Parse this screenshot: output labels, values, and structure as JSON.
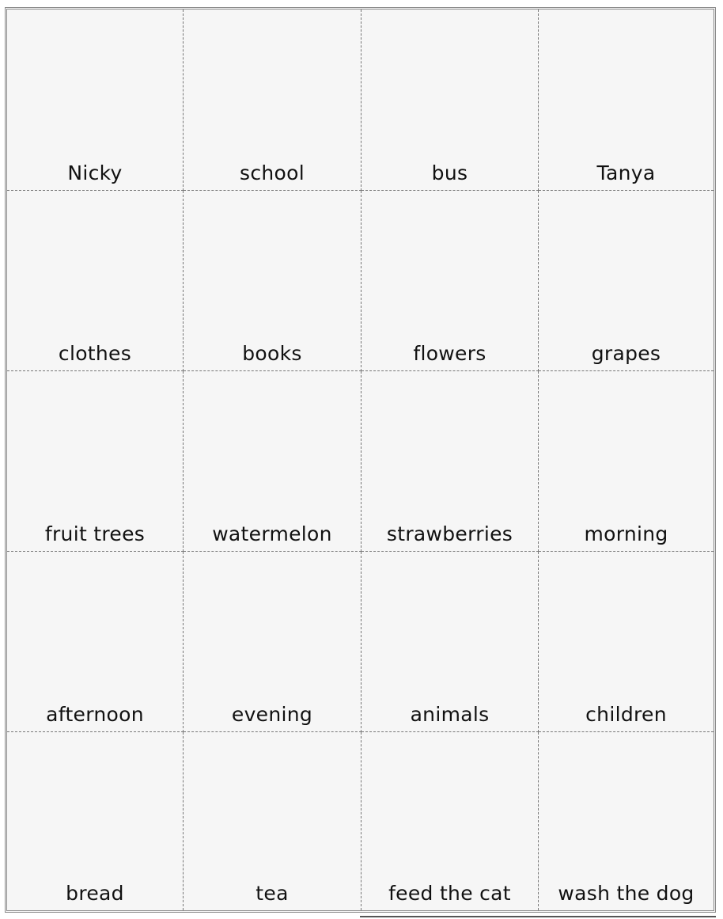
{
  "cards": [
    "Nicky",
    "school",
    "bus",
    "Tanya",
    "clothes",
    "books",
    "flowers",
    "grapes",
    "fruit trees",
    "watermelon",
    "strawberries",
    "morning",
    "afternoon",
    "evening",
    "animals",
    "children",
    "bread",
    "tea",
    "feed the cat",
    "wash the dog"
  ]
}
